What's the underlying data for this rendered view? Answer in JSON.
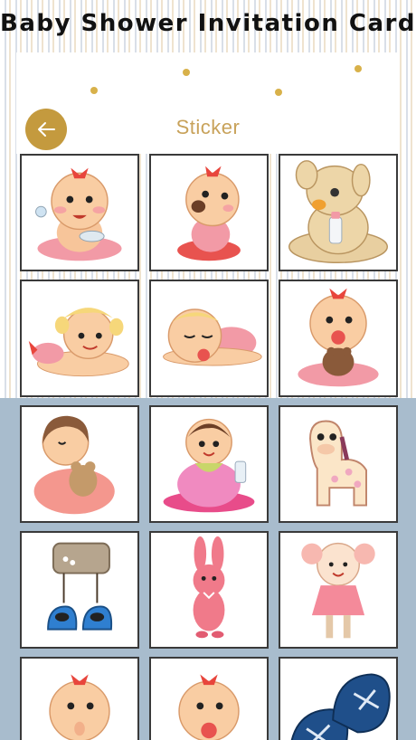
{
  "app": {
    "title": "Baby Shower Invitation Card"
  },
  "header": {
    "title": "Sticker",
    "back_icon": "arrow-left-icon",
    "accent": "#c49a3e"
  },
  "stickers": [
    {
      "name": "baby-girl-bowl-sticker"
    },
    {
      "name": "baby-girl-eating-sticker"
    },
    {
      "name": "teddy-bear-bottle-sticker"
    },
    {
      "name": "baby-girl-crawling-sticker"
    },
    {
      "name": "baby-sleeping-pacifier-sticker"
    },
    {
      "name": "baby-pacifier-teddy-sticker"
    },
    {
      "name": "girl-hugging-teddy-sticker"
    },
    {
      "name": "baby-bib-bottle-sticker"
    },
    {
      "name": "toy-giraffe-sticker"
    },
    {
      "name": "baby-shoes-sign-sticker"
    },
    {
      "name": "pink-bunny-sticker"
    },
    {
      "name": "rag-doll-sticker"
    },
    {
      "name": "baby-thumb-sticker"
    },
    {
      "name": "baby-pacifier-sticker"
    },
    {
      "name": "blue-baby-shoes-sticker"
    }
  ]
}
